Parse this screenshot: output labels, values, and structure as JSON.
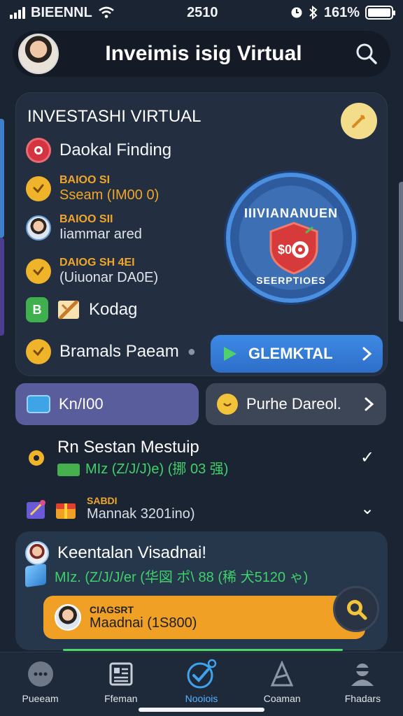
{
  "status_bar": {
    "carrier": "BIEENNL",
    "time": "2510",
    "battery_text": "161%"
  },
  "header": {
    "title": "Inveimis isig Virtual"
  },
  "main_card": {
    "title": "INVESTASHI VIRTUAL",
    "features": [
      {
        "label": "Daokal Finding"
      },
      {
        "line1": "BAIOO SI",
        "line2": "Sseam (IM00 0)"
      },
      {
        "line1": "BAIOO SII",
        "line2": "Iiammar ared"
      },
      {
        "line1": "DAIOG SH 4EI",
        "line2": "(Uiuonar DA0E)"
      },
      {
        "label": "Kodag",
        "green_icon_text": "B"
      },
      {
        "label": "Bramals Paeam"
      }
    ],
    "badge": {
      "top_text": "IIIVIANANUEN",
      "bottom_text": "SEERPTIOES",
      "shield_text": "$0"
    },
    "cta_button": "GLEMKTAL"
  },
  "tiles": {
    "left": "Kn/I00",
    "right": "Purhe Dareol."
  },
  "list": [
    {
      "title": "Rn Sestan Mestuip",
      "sub": "MIz (Z/J/J)e) (挪 03 强)"
    },
    {
      "small": "SABDI",
      "sub": "Mannak 3201ino)"
    }
  ],
  "bottom_card": {
    "title": "Keentalan Visadnai!",
    "sub": "MIz. (Z/J/J/er (华図 ポ\\ 88 (稀 犬5120 ゃ)"
  },
  "orange_bar": {
    "line1": "CIAGSRT",
    "line2": "Maadnai (1S800)"
  },
  "tabs": [
    {
      "label": "Pueeam",
      "icon": "chat-bubble-icon"
    },
    {
      "label": "Ffeman",
      "icon": "document-list-icon"
    },
    {
      "label": "Nooiois",
      "icon": "checkmark-circle-icon"
    },
    {
      "label": "Coaman",
      "icon": "compass-icon"
    },
    {
      "label": "Fhadars",
      "icon": "person-icon"
    }
  ],
  "colors": {
    "background": "#1b2433",
    "accent_blue": "#3d8ae6",
    "accent_orange": "#f0a025",
    "accent_green": "#3fd16a",
    "gold": "#f0b42a"
  }
}
